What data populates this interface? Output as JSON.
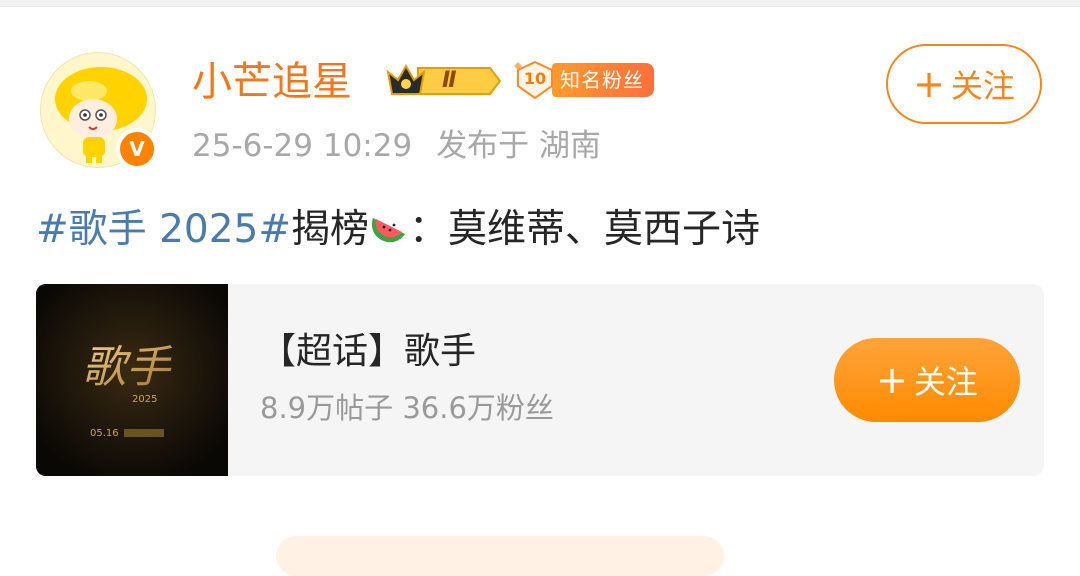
{
  "post": {
    "author": {
      "name": "小芒追星",
      "verified": true,
      "crown_badge_level": "Ⅱ",
      "fan_badge": {
        "level": "10",
        "label": "知名粉丝"
      }
    },
    "timestamp": "25-6-29 10:29",
    "location": "发布于 湖南",
    "follow_label": "关注",
    "text": {
      "hashtag": "#歌手 2025#",
      "body_before_emoji": "揭榜",
      "emoji": "watermelon-emoji",
      "body_after_emoji": "：莫维蒂、莫西子诗"
    }
  },
  "topic_card": {
    "title": "【超话】歌手",
    "stats": "8.9万帖子 36.6万粉丝",
    "follow_label": "关注",
    "thumb_text": {
      "title": "歌手",
      "year": "2025",
      "date": "05.16"
    }
  },
  "colors": {
    "accent": "#f4761a",
    "hashtag": "#4a7bb0",
    "card_bg": "#f5f5f5",
    "follow_fill": "#ff8a00"
  },
  "icons": {
    "verify": "verified-v-icon",
    "crown": "crown-icon",
    "plus": "plus-icon"
  }
}
